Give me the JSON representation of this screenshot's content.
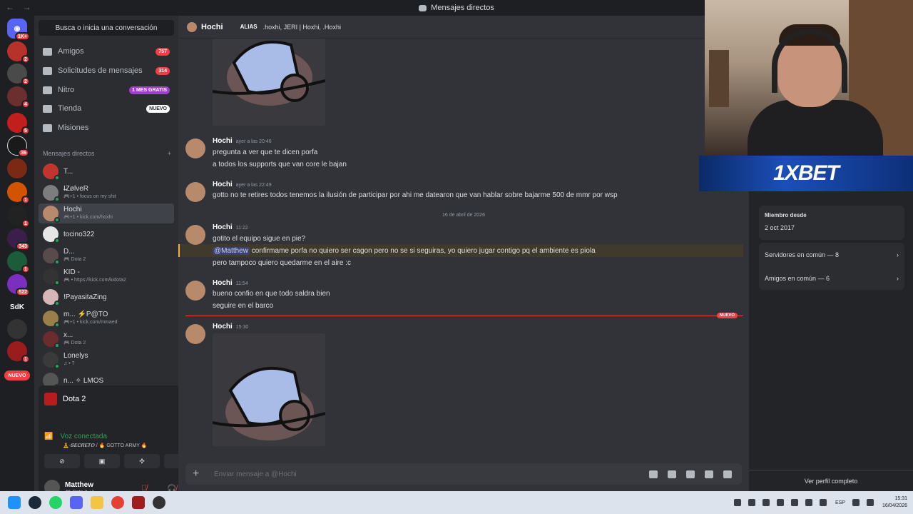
{
  "window": {
    "title": "Mensajes directos",
    "nav_arrows": "← →"
  },
  "rail": {
    "badges": [
      "1K+",
      "2",
      "2",
      "4",
      "5",
      "36",
      "",
      "1",
      "1",
      "343",
      "1",
      "522",
      "",
      "",
      "1"
    ],
    "text_server": "SdK",
    "nuevo": "NUEVO"
  },
  "sidebar": {
    "search": "Busca o inicia una conversación",
    "nav": [
      {
        "label": "Amigos",
        "count": "757",
        "kind": "red"
      },
      {
        "label": "Solicitudes de mensajes",
        "count": "314",
        "kind": "red"
      },
      {
        "label": "Nitro",
        "count": "1 MES GRATIS",
        "kind": "purple"
      },
      {
        "label": "Tienda",
        "count": "NUEVO",
        "kind": "white"
      },
      {
        "label": "Misiones",
        "count": "",
        "kind": ""
      }
    ],
    "dm_header": "Mensajes directos",
    "dm_add": "+",
    "dms": [
      {
        "name": "T...",
        "sub": "",
        "color": "#c2342f"
      },
      {
        "name": "I̶ZølveR",
        "sub": "🎮+1 • focus on my shit",
        "color": "#7d7d7d"
      },
      {
        "name": "Hochi",
        "sub": "🎮+1 • kick.com/hoxhi",
        "color": "#b88a6c"
      },
      {
        "name": "tocino322",
        "sub": "",
        "color": "#e6e6e6"
      },
      {
        "name": "D...",
        "sub": "🎮 Dota 2",
        "color": "#594b4b"
      },
      {
        "name": "KID -",
        "sub": "🎮 • https://kick.com/kidota2",
        "color": "#333"
      },
      {
        "name": "!PayasitaZing",
        "sub": "",
        "color": "#d6b6b6"
      },
      {
        "name": "m... ⚡P@TO",
        "sub": "🎮+1 • kick.com/mmaed",
        "color": "#9a7f4a"
      },
      {
        "name": "x...",
        "sub": "🎮 Dota 2",
        "color": "#6a2c2c"
      },
      {
        "name": "Lonelys",
        "sub": "♫ • ?",
        "color": "#3a3a3a"
      },
      {
        "name": "n... ✧ LMOS",
        "sub": "",
        "color": "#555"
      }
    ]
  },
  "voice": {
    "game": "Dota 2",
    "status": "Voz conectada",
    "channel": "🧘-𝑺𝑬𝑪𝑹𝑬𝑻𝑶 / 🔥 GOTTO ARMY 🔥",
    "buttons": [
      "⊘",
      "▣",
      "✣",
      "✺"
    ]
  },
  "user": {
    "name": "Matthew",
    "status": "🎮 Dota 2 +1"
  },
  "chat": {
    "recipient": "Hochi",
    "alias_label": "ALIAS",
    "aliases": ".hoxhi, JERI | Hoxhi, .Hoxhi",
    "messages": [
      {
        "user": "Hochi",
        "time": "ayer a las 20:46",
        "lines": [
          "pregunta a ver que te dicen porfa",
          "a todos los supports que van core le bajan"
        ]
      },
      {
        "user": "Hochi",
        "time": "ayer a las 22:49",
        "lines": [
          "gotto no te retires todos tenemos la ilusión de participar por ahi me datearon que van hablar sobre bajarme 500 de mmr por wsp"
        ]
      },
      {
        "user": "Hochi",
        "time": "11:22",
        "lines": [
          "gotito el equipo sigue en pie?",
          "pero tampoco quiero quedarme en el aire :c"
        ],
        "mention": "@Matthew",
        "mention_text": " confirmame porfa no quiero ser cagon pero no se si seguiras, yo quiero jugar contigo pq el ambiente es piola"
      },
      {
        "user": "Hochi",
        "time": "11:54",
        "lines": [
          "bueno confio en que todo saldra bien",
          "seguire en el barco"
        ]
      },
      {
        "user": "Hochi",
        "time": "15:30",
        "lines": []
      }
    ],
    "date_divider": "16 de abril de 2026",
    "new_tag": "NUEVO",
    "composer_placeholder": "Enviar mensaje a @Hochi"
  },
  "profile": {
    "ad_text": "1XBET",
    "member_since_label": "Miembro desde",
    "member_since": "2 oct 2017",
    "servers_common": "Servidores en común — 8",
    "friends_common": "Amigos en común — 6",
    "full_profile": "Ver perfil completo"
  },
  "taskbar": {
    "lang": "ESP",
    "time": "15:31",
    "date": "16/04/2026"
  },
  "colors": {
    "accent": "#5865f2",
    "online": "#23a55a",
    "danger": "#f23f43"
  }
}
